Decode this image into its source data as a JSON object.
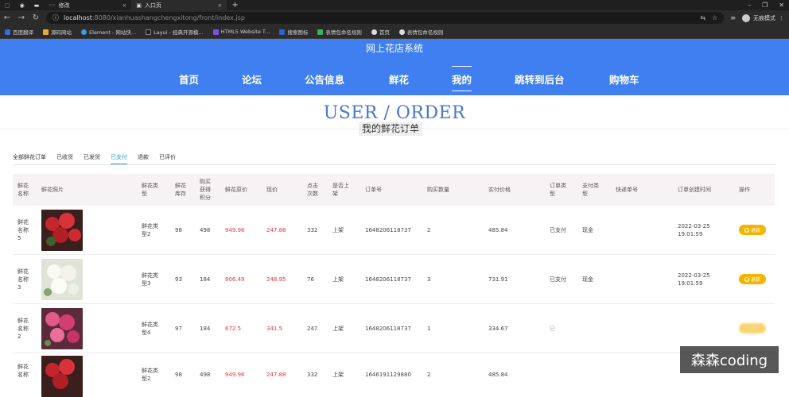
{
  "browser": {
    "tabs": [
      {
        "label": "",
        "active": false
      },
      {
        "label": "",
        "active": false
      },
      {
        "label": "",
        "active": false
      },
      {
        "label": "修改",
        "active": false
      },
      {
        "label": "入口页",
        "active": true
      }
    ],
    "url_host": "localhost",
    "url_path": ":8080/xianhuashangchengxitong/front/index.jsp",
    "profile_label": "无痕模式",
    "bookmarks": [
      "百度翻译",
      "源码网站",
      "Element - 网站快...",
      "Layui - 经典开源模...",
      "HTML5 Website T...",
      "搜索图标",
      "表情包命名规则",
      "首页",
      "表情包命名规则"
    ]
  },
  "site": {
    "title": "网上花店系统",
    "nav": [
      "首页",
      "论坛",
      "公告信息",
      "鲜花",
      "我的",
      "跳转到后台",
      "购物车"
    ],
    "active_nav": "我的",
    "hero_en": "USER / ORDER",
    "hero_cn": "我的鲜花订单"
  },
  "order_tabs": [
    "全部鲜花订单",
    "已收货",
    "已发货",
    "已支付",
    "退款",
    "已评价"
  ],
  "active_order_tab": "已支付",
  "table": {
    "headers": [
      "鲜花名称",
      "鲜花照片",
      "鲜花类型",
      "鲜花库存",
      "购买获得积分",
      "鲜花原价",
      "现价",
      "点击次数",
      "是否上架",
      "订单号",
      "购买数量",
      "实付价格",
      "订单类型",
      "支付类型",
      "快递单号",
      "订单创建时间",
      "操作"
    ],
    "rows": [
      {
        "name": "鲜花名称5",
        "type": "鲜花类型2",
        "stock": "98",
        "points": "498",
        "orig": "949.96",
        "price": "247.88",
        "clicks": "332",
        "shelf": "上架",
        "order_no": "1648206118737",
        "qty": "2",
        "paid": "485.84",
        "order_type": "已支付",
        "pay_type": "现金",
        "express": "",
        "created": "2022-03-25 19:01:59",
        "action": "退款",
        "photo": "red"
      },
      {
        "name": "鲜花名称3",
        "type": "鲜花类型3",
        "stock": "93",
        "points": "184",
        "orig": "806.49",
        "price": "248.95",
        "clicks": "76",
        "shelf": "上架",
        "order_no": "1648206118737",
        "qty": "3",
        "paid": "731.91",
        "order_type": "已支付",
        "pay_type": "现金",
        "express": "",
        "created": "2022-03-25 19:01:59",
        "action": "退款",
        "photo": "white"
      },
      {
        "name": "鲜花名称2",
        "type": "鲜花类型4",
        "stock": "97",
        "points": "184",
        "orig": "672.5",
        "price": "341.5",
        "clicks": "247",
        "shelf": "上架",
        "order_no": "1648206118737",
        "qty": "1",
        "paid": "334.67",
        "order_type": "已",
        "pay_type": "",
        "express": "",
        "created": "",
        "action": "",
        "photo": "pink"
      },
      {
        "name": "鲜花名称",
        "type": "鲜花类型2",
        "stock": "98",
        "points": "498",
        "orig": "949.96",
        "price": "247.88",
        "clicks": "332",
        "shelf": "上架",
        "order_no": "1646191129880",
        "qty": "2",
        "paid": "485.84",
        "order_type": "",
        "pay_type": "",
        "express": "",
        "created": "",
        "action": "",
        "photo": "red"
      }
    ]
  },
  "watermark": "森森coding",
  "colors": {
    "header_blue": "#3f7ff0",
    "accent_blue": "#2a9bd5",
    "price_red": "#e1373a",
    "refund_yellow": "#f4b400"
  }
}
